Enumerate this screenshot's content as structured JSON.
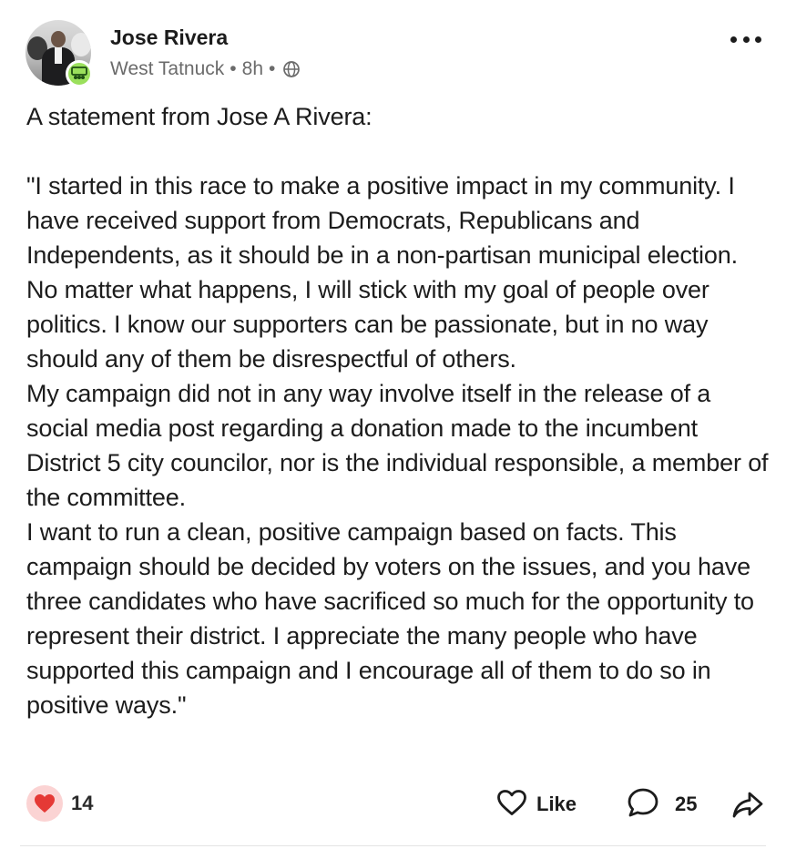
{
  "post": {
    "author": "Jose Rivera",
    "group": "West Tatnuck",
    "separator": "•",
    "time": "8h",
    "privacy_icon": "globe-icon",
    "group_badge_icon": "group-icon",
    "more_icon": "more-options-icon",
    "paragraphs": [
      "A statement from Jose A Rivera:",
      "",
      "\"I started in this race to make a positive impact in my community. I have received support from Democrats, Republicans and Independents, as it should be in a non-partisan municipal election. No matter what happens, I will stick with my goal of people over politics. I know our supporters can be passionate, but in no way should any of them be disrespectful of others.",
      "My campaign did not in any way involve itself in the release of a social media post regarding a donation made to the incumbent District 5 city councilor, nor is the individual responsible, a member of the committee.",
      "I want to run a clean, positive campaign based on facts. This campaign should be decided by voters on the issues, and you have three candidates who have sacrificed so much for the opportunity to represent their district. I appreciate the many people who have supported this campaign and I encourage all of them to do so in positive ways.\""
    ]
  },
  "footer": {
    "reaction_icon": "heart-icon",
    "reaction_count": "14",
    "like_label": "Like",
    "comment_count": "25",
    "share_icon": "share-icon"
  },
  "colors": {
    "badge": "#9be05c",
    "heart": "#e53935",
    "heart_bg": "#fbd3d3",
    "meta_text": "#6b6b6b"
  }
}
